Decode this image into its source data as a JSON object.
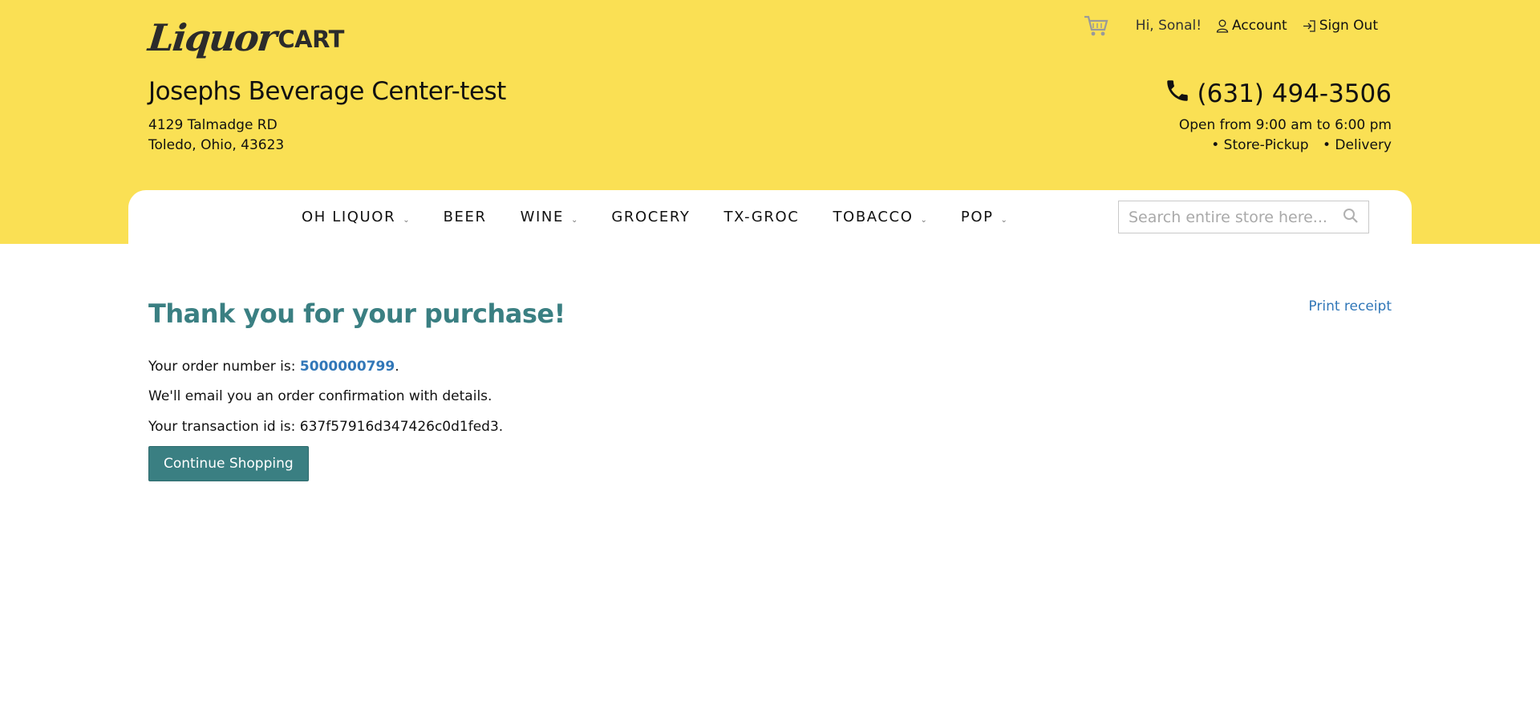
{
  "brand": {
    "logo_script": "Liquor",
    "logo_suffix": "CART"
  },
  "topbar": {
    "greeting": "Hi, Sonal!",
    "account_label": "Account",
    "signout_label": "Sign Out"
  },
  "store": {
    "name": "Josephs Beverage Center-test",
    "address_line1": "4129 Talmadge RD",
    "address_line2": "Toledo, Ohio, 43623",
    "phone": "(631) 494-3506",
    "hours": "Open from 9:00 am to 6:00 pm",
    "options": [
      "• Store-Pickup",
      "• Delivery"
    ]
  },
  "nav": {
    "items": [
      {
        "label": "OH LIQUOR",
        "dropdown": "⌄"
      },
      {
        "label": "BEER",
        "dropdown": ""
      },
      {
        "label": "WINE",
        "dropdown": "⌄"
      },
      {
        "label": "GROCERY",
        "dropdown": ""
      },
      {
        "label": "TX-GROC",
        "dropdown": ""
      },
      {
        "label": "TOBACCO",
        "dropdown": "⌄"
      },
      {
        "label": "POP",
        "dropdown": "⌄"
      }
    ],
    "search_placeholder": "Search entire store here..."
  },
  "confirmation": {
    "title": "Thank you for your purchase!",
    "print_label": "Print receipt",
    "order_prefix": "Your order number is: ",
    "order_number": "5000000799",
    "order_suffix": ".",
    "email_note": "We'll email you an order confirmation with details.",
    "transaction_text": "Your transaction id is: 637f57916d347426c0d1fed3.",
    "continue_label": "Continue Shopping"
  },
  "colors": {
    "header_bg": "#fae054",
    "accent_teal": "#3a7f82",
    "link_blue": "#3177b8"
  }
}
